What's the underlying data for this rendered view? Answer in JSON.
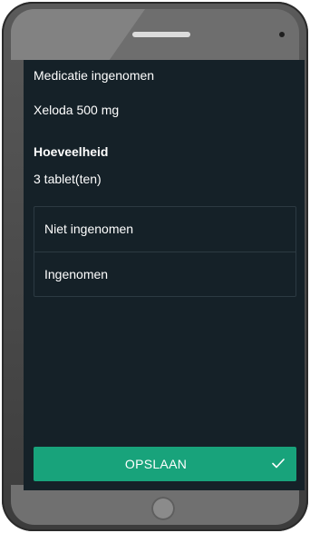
{
  "screen": {
    "section_title": "Medicatie ingenomen",
    "medication_name": "Xeloda 500 mg",
    "quantity_label": "Hoeveelheid",
    "quantity_value": "3 tablet(ten)"
  },
  "options": [
    {
      "label": "Niet ingenomen"
    },
    {
      "label": "Ingenomen"
    }
  ],
  "save_button": {
    "label": "OPSLAAN",
    "icon": "check-icon"
  },
  "colors": {
    "screen_background": "#152128",
    "accent": "#18a37b",
    "text": "#ffffff"
  }
}
